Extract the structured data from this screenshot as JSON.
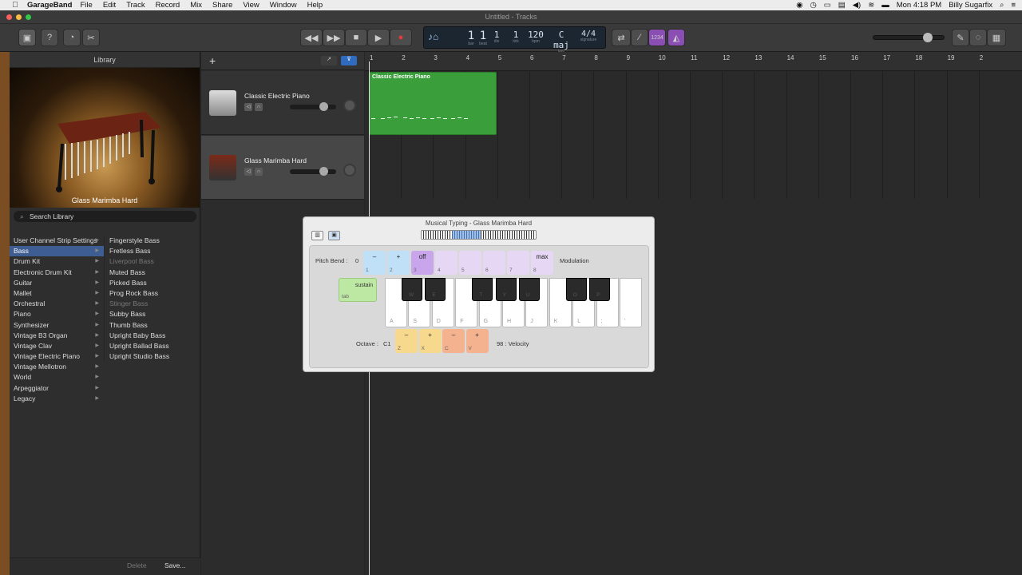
{
  "menubar": {
    "apple": "",
    "app_name": "GarageBand",
    "items": [
      "File",
      "Edit",
      "Track",
      "Record",
      "Mix",
      "Share",
      "View",
      "Window",
      "Help"
    ],
    "clock": "Mon 4:18 PM",
    "user": "Billy Sugarfix"
  },
  "window": {
    "title": "Untitled - Tracks"
  },
  "toolbar": {
    "lcd": {
      "bar": {
        "value": "1",
        "label": "bar"
      },
      "beat": {
        "value": "1",
        "label": "beat"
      },
      "div": {
        "value": "1",
        "label": "div"
      },
      "tick": {
        "value": "1",
        "label": "tick"
      },
      "bpm": {
        "value": "120",
        "label": "bpm"
      },
      "key": {
        "value": "C maj",
        "label": "key"
      },
      "signature": {
        "value": "4/4",
        "label": "signature"
      }
    },
    "count_in": "1234"
  },
  "library": {
    "title": "Library",
    "instrument_label": "Glass Marimba Hard",
    "search_placeholder": "Search Library",
    "categories": [
      {
        "label": "User Channel Strip Settings"
      },
      {
        "label": "Bass",
        "selected": true
      },
      {
        "label": "Drum Kit"
      },
      {
        "label": "Electronic Drum Kit"
      },
      {
        "label": "Guitar"
      },
      {
        "label": "Mallet"
      },
      {
        "label": "Orchestral"
      },
      {
        "label": "Piano"
      },
      {
        "label": "Synthesizer"
      },
      {
        "label": "Vintage B3 Organ"
      },
      {
        "label": "Vintage Clav"
      },
      {
        "label": "Vintage Electric Piano"
      },
      {
        "label": "Vintage Mellotron"
      },
      {
        "label": "World"
      },
      {
        "label": "Arpeggiator"
      },
      {
        "label": "Legacy"
      }
    ],
    "patches": [
      {
        "label": "Fingerstyle Bass"
      },
      {
        "label": "Fretless Bass"
      },
      {
        "label": "Liverpool Bass",
        "dim": true
      },
      {
        "label": "Muted Bass"
      },
      {
        "label": "Picked Bass"
      },
      {
        "label": "Prog Rock Bass"
      },
      {
        "label": "Stinger Bass",
        "dim": true
      },
      {
        "label": "Subby Bass"
      },
      {
        "label": "Thumb Bass"
      },
      {
        "label": "Upright Baby Bass"
      },
      {
        "label": "Upright Ballad Bass"
      },
      {
        "label": "Upright Studio Bass"
      }
    ],
    "delete_label": "Delete",
    "save_label": "Save..."
  },
  "tracks": [
    {
      "name": "Classic Electric Piano"
    },
    {
      "name": "Glass Marimba Hard"
    }
  ],
  "ruler": [
    "1",
    "2",
    "3",
    "4",
    "5",
    "6",
    "7",
    "8",
    "9",
    "10",
    "11",
    "12",
    "13",
    "14",
    "15",
    "16",
    "17",
    "18",
    "19",
    "2"
  ],
  "region": {
    "name": "Classic Electric Piano",
    "color": "#3a9e3a"
  },
  "musical_typing": {
    "title": "Musical Typing - Glass Marimba Hard",
    "pitch_bend_label": "Pitch Bend :",
    "pitch_bend_value": "0",
    "modulation_label": "Modulation",
    "top_keys": [
      {
        "top": "–",
        "sub": "1",
        "color": "#bfe0f7"
      },
      {
        "top": "+",
        "sub": "2",
        "color": "#bfe0f7"
      },
      {
        "top": "off",
        "sub": "3",
        "color": "#c9a6ec"
      },
      {
        "top": "",
        "sub": "4",
        "color": "#e6d8f4"
      },
      {
        "top": "",
        "sub": "5",
        "color": "#e6d8f4"
      },
      {
        "top": "",
        "sub": "6",
        "color": "#e6d8f4"
      },
      {
        "top": "",
        "sub": "7",
        "color": "#e6d8f4"
      },
      {
        "top": "max",
        "sub": "8",
        "color": "#e6d8f4"
      }
    ],
    "sustain_label": "sustain",
    "sustain_key": "tab",
    "white_keys": [
      "A",
      "S",
      "D",
      "F",
      "G",
      "H",
      "J",
      "K",
      "L",
      ";",
      "'"
    ],
    "black_keys": [
      "W",
      "E",
      "",
      "T",
      "Y",
      "U",
      "",
      "O",
      "P"
    ],
    "octave_label": "Octave :",
    "octave_value": "C1",
    "octave_keys": [
      {
        "top": "–",
        "sub": "Z",
        "color": "#f7d98e"
      },
      {
        "top": "+",
        "sub": "X",
        "color": "#f7d98e"
      },
      {
        "top": "–",
        "sub": "C",
        "color": "#f4b28f"
      },
      {
        "top": "+",
        "sub": "V",
        "color": "#f4b28f"
      }
    ],
    "velocity_label": "98 : Velocity"
  }
}
